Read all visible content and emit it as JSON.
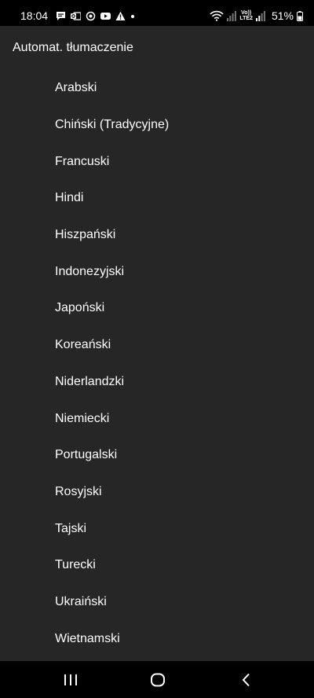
{
  "status_bar": {
    "time": "18:04",
    "network_label_top": "Vo))",
    "network_label_bottom": "LTE2",
    "battery": "51%",
    "icons": [
      "chat-icon",
      "outlook-icon",
      "sync-icon",
      "youtube-icon",
      "warning-icon",
      "dot-icon",
      "wifi-icon",
      "signal-icon",
      "signal-icon",
      "battery-icon"
    ]
  },
  "panel": {
    "title": "Automat. tłumaczenie",
    "languages": [
      "Arabski",
      "Chiński (Tradycyjne)",
      "Francuski",
      "Hindi",
      "Hiszpański",
      "Indonezyjski",
      "Japoński",
      "Koreański",
      "Niderlandzki",
      "Niemiecki",
      "Portugalski",
      "Rosyjski",
      "Tajski",
      "Turecki",
      "Ukraiński",
      "Wietnamski"
    ]
  },
  "nav_bar": {
    "icons": [
      "recent-apps-icon",
      "home-icon",
      "back-icon"
    ]
  },
  "colors": {
    "panel_background": "#262626",
    "bar_background": "#000000",
    "text": "#ffffff"
  }
}
